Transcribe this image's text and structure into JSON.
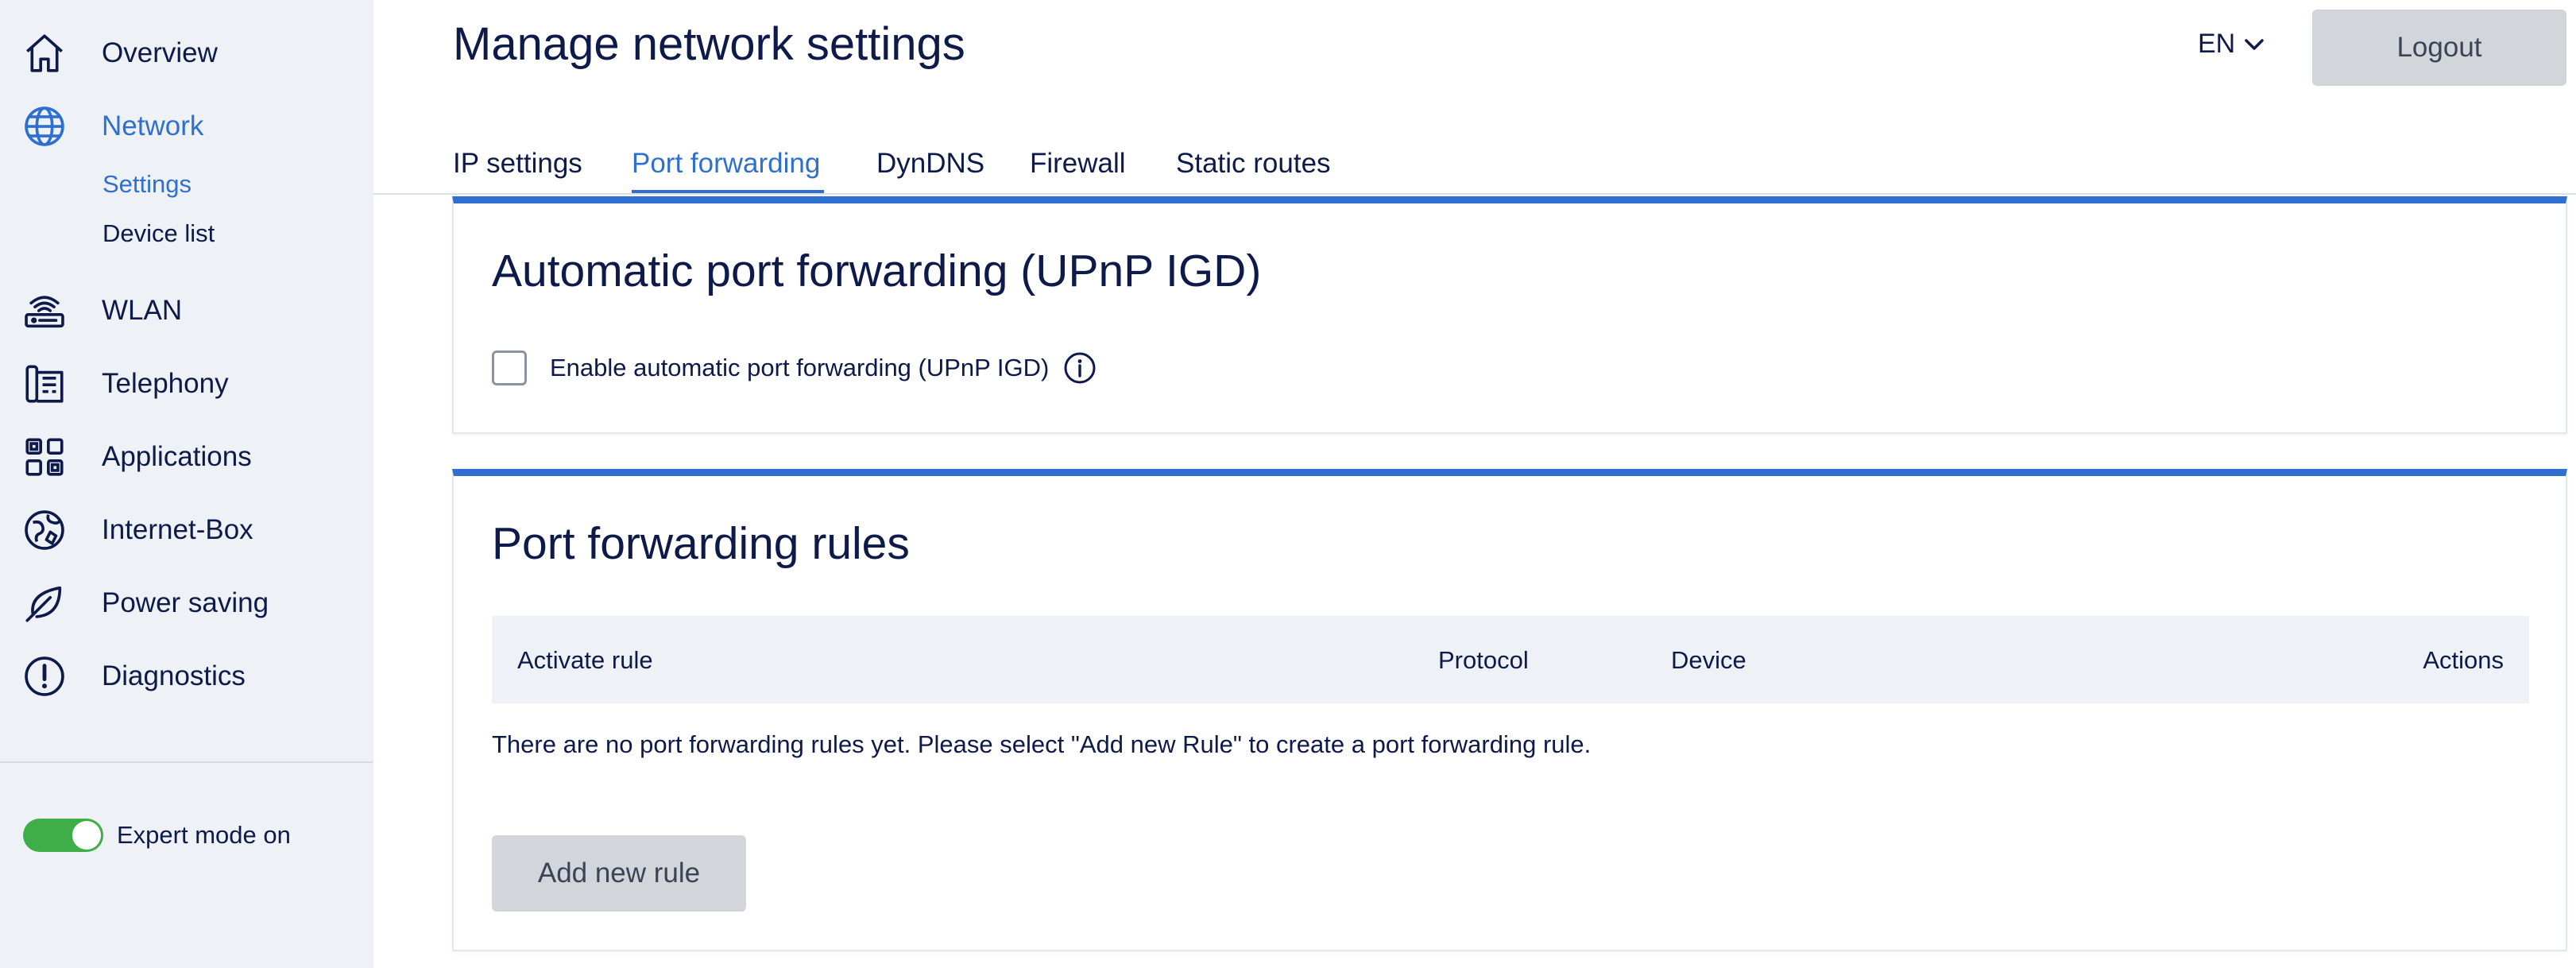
{
  "sidebar": {
    "items": [
      {
        "label": "Overview",
        "icon": "home-icon"
      },
      {
        "label": "Network",
        "icon": "globe-icon"
      },
      {
        "label": "WLAN",
        "icon": "router-icon"
      },
      {
        "label": "Telephony",
        "icon": "phone-icon"
      },
      {
        "label": "Applications",
        "icon": "apps-icon"
      },
      {
        "label": "Internet-Box",
        "icon": "internet-box-icon"
      },
      {
        "label": "Power saving",
        "icon": "leaf-icon"
      },
      {
        "label": "Diagnostics",
        "icon": "alert-icon"
      }
    ],
    "network_sub": [
      {
        "label": "Settings"
      },
      {
        "label": "Device list"
      }
    ],
    "expert_mode": {
      "label": "Expert mode on",
      "on": true
    }
  },
  "header": {
    "title": "Manage network settings",
    "language": "EN",
    "logout_label": "Logout"
  },
  "tabs": [
    {
      "label": "IP settings"
    },
    {
      "label": "Port forwarding"
    },
    {
      "label": "DynDNS"
    },
    {
      "label": "Firewall"
    },
    {
      "label": "Static routes"
    }
  ],
  "upnp": {
    "title": "Automatic port forwarding (UPnP IGD)",
    "checkbox_label": "Enable automatic port forwarding (UPnP IGD)",
    "checked": false
  },
  "rules": {
    "title": "Port forwarding rules",
    "columns": [
      "Activate rule",
      "Protocol",
      "Device",
      "Actions"
    ],
    "empty_message": "There are no port forwarding rules yet. Please select \"Add new Rule\" to create a port forwarding rule.",
    "add_button_label": "Add new rule"
  },
  "colors": {
    "accent": "#2f6fd1",
    "text": "#0d1a4a",
    "sidebar_bg": "#eef2f6",
    "toggle_on": "#3fae49",
    "button_gray": "#d2d5d9"
  }
}
